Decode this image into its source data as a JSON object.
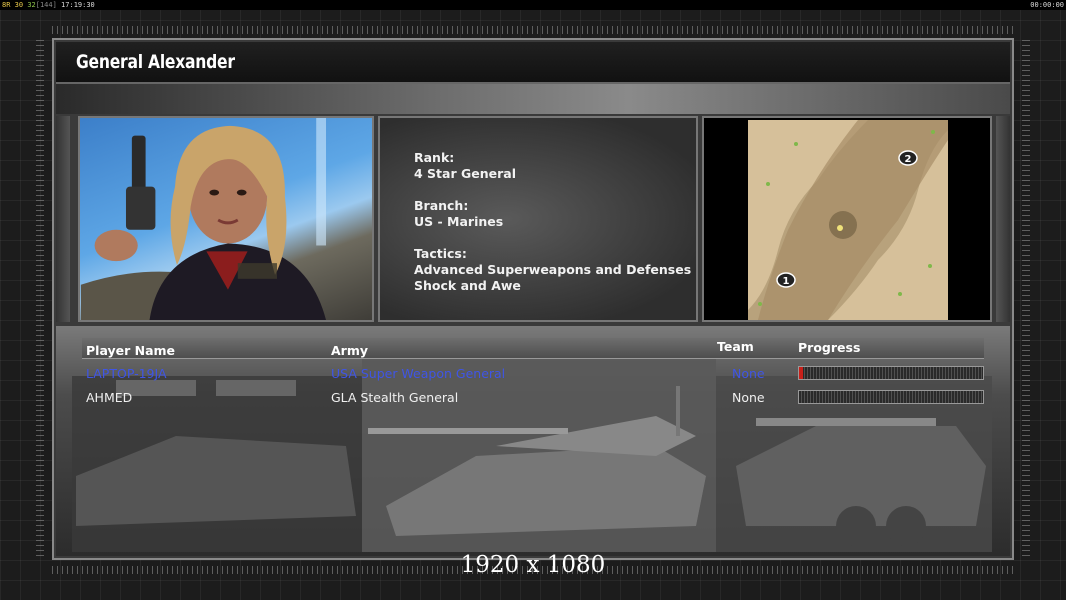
{
  "status_bar": {
    "fps_a": "8R",
    "fps_b": "30",
    "fps_c": "32",
    "fps_d": "[144]",
    "clock": "17:19:30",
    "timer": "00:00:00"
  },
  "title": "General Alexander",
  "info": {
    "rank_label": "Rank:",
    "rank_value": "4 Star General",
    "branch_label": "Branch:",
    "branch_value": "US - Marines",
    "tactics_label": "Tactics:",
    "tactics_line1": "Advanced Superweapons and Defenses",
    "tactics_line2": "Shock and Awe"
  },
  "map": {
    "start_1": "1",
    "start_2": "2"
  },
  "table": {
    "headers": {
      "player_name": "Player Name",
      "army": "Army",
      "team": "Team",
      "progress": "Progress"
    },
    "rows": [
      {
        "name": "LAPTOP-19JA",
        "army": "USA Super Weapon General",
        "team": "None",
        "progress": 0.02,
        "color": "#3f55e6"
      },
      {
        "name": "AHMED",
        "army": "GLA Stealth General",
        "team": "None",
        "progress": 0.0,
        "color": "#f0f0f0"
      }
    ]
  },
  "overlay_caption": "1920 x 1080",
  "colors": {
    "human_player": "#3f55e6",
    "ai_player": "#f0f0f0",
    "progress_fill": "#c8201a"
  }
}
